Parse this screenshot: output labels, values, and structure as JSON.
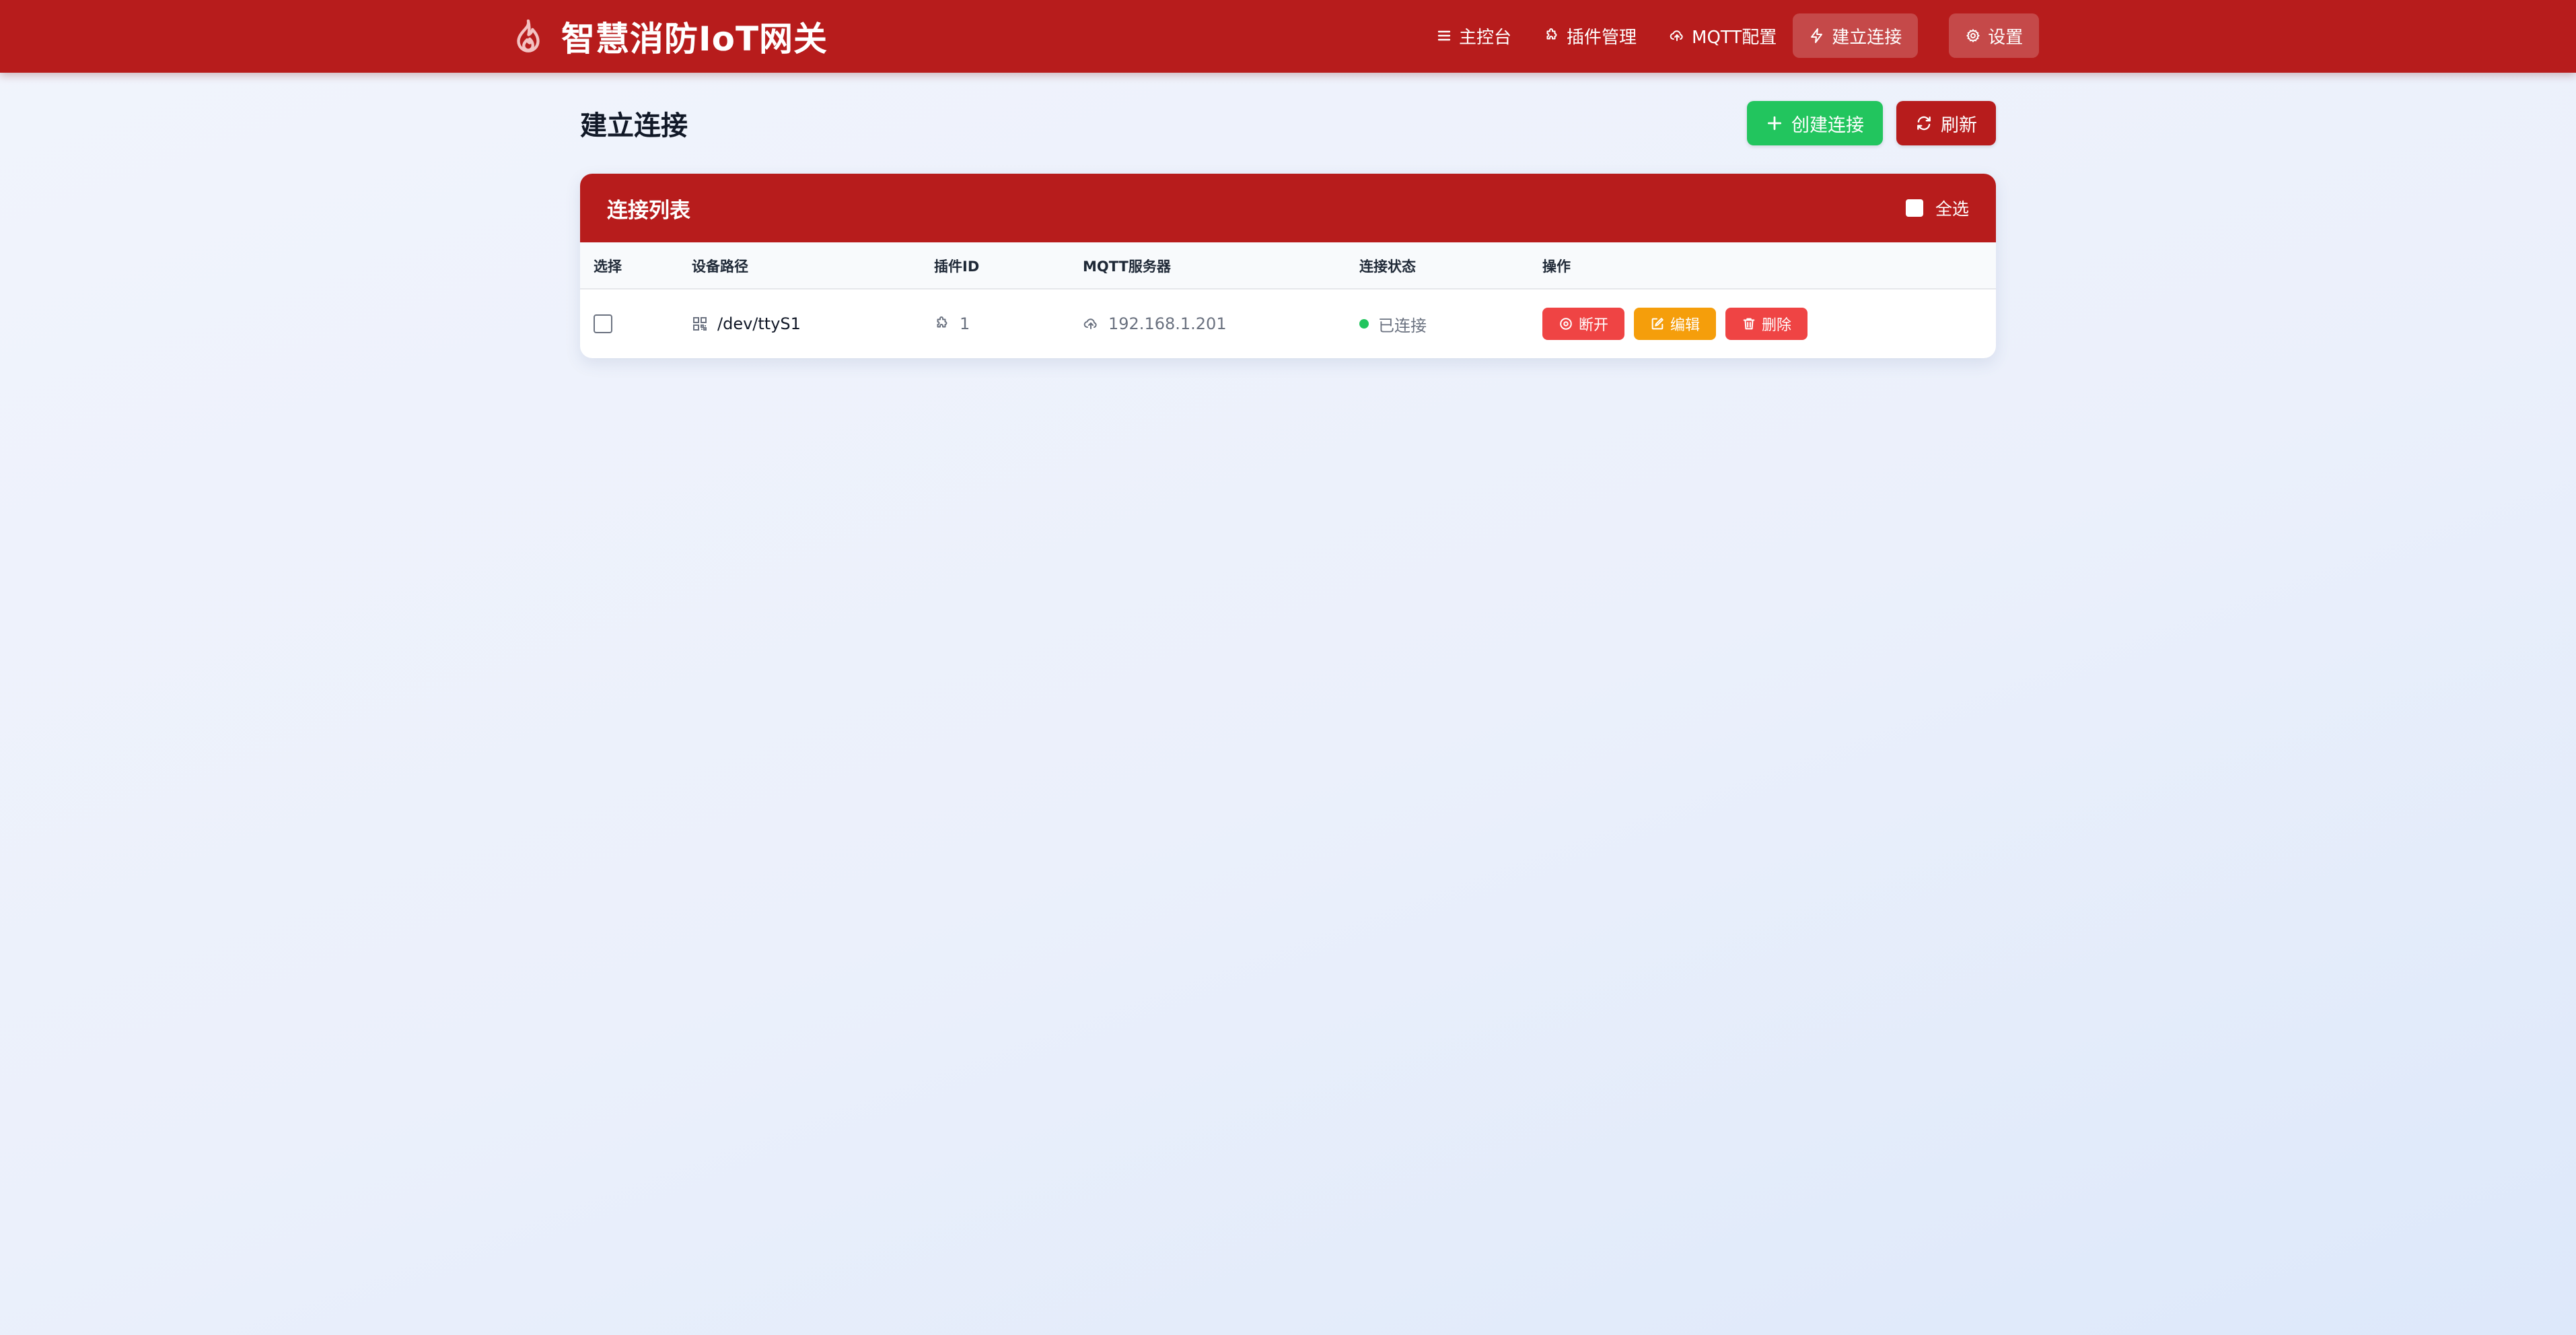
{
  "app": {
    "title": "智慧消防IoT网关"
  },
  "nav": {
    "dashboard": "主控台",
    "plugins": "插件管理",
    "mqtt": "MQTT配置",
    "connect": "建立连接",
    "settings": "设置"
  },
  "page": {
    "title": "建立连接",
    "create_label": "创建连接",
    "refresh_label": "刷新"
  },
  "card": {
    "title": "连接列表",
    "select_all": "全选"
  },
  "table": {
    "columns": [
      "选择",
      "设备路径",
      "插件ID",
      "MQTT服务器",
      "连接状态",
      "操作"
    ],
    "rows": [
      {
        "selected": false,
        "device_path": "/dev/ttyS1",
        "plugin_id": "1",
        "mqtt_server": "192.168.1.201",
        "status": "已连接",
        "actions": {
          "disconnect": "断开",
          "edit": "编辑",
          "delete": "删除"
        }
      }
    ]
  },
  "colors": {
    "brand": "#b71c1c",
    "success": "#22c55e",
    "warning": "#f59e0b",
    "danger": "#ef4444"
  },
  "icons": {
    "brand": "flame-icon",
    "dashboard": "menu-lines-icon",
    "plugins": "puzzle-icon",
    "mqtt": "cloud-upload-icon",
    "connect": "lightning-icon",
    "settings": "gear-icon"
  }
}
